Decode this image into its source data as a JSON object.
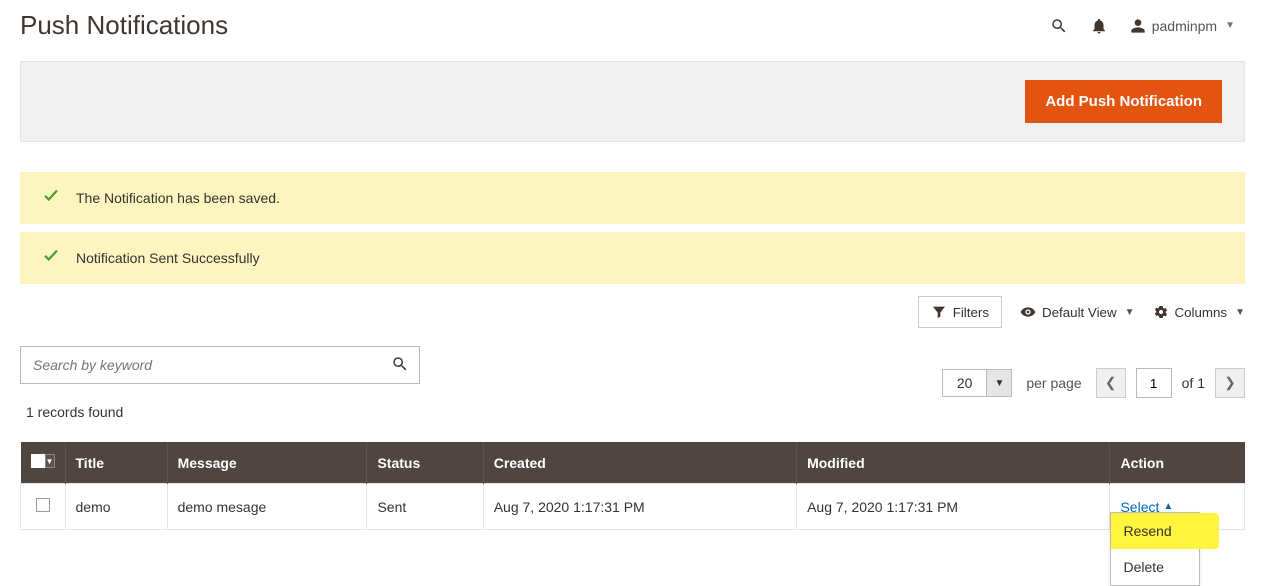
{
  "header": {
    "title": "Push Notifications",
    "user": "padminpm"
  },
  "primaryButton": "Add Push Notification",
  "messages": [
    "The Notification has been saved.",
    "Notification Sent Successfully"
  ],
  "toolbar": {
    "filters": "Filters",
    "defaultView": "Default View",
    "columns": "Columns"
  },
  "search": {
    "placeholder": "Search by keyword",
    "recordsFound": "1 records found"
  },
  "pager": {
    "perPageValue": "20",
    "perPageLabel": "per page",
    "current": "1",
    "ofLabel": "of 1"
  },
  "table": {
    "columns": {
      "title": "Title",
      "message": "Message",
      "status": "Status",
      "created": "Created",
      "modified": "Modified",
      "action": "Action"
    },
    "rows": [
      {
        "title": "demo",
        "message": "demo mesage",
        "status": "Sent",
        "created": "Aug 7, 2020 1:17:31 PM",
        "modified": "Aug 7, 2020 1:17:31 PM"
      }
    ],
    "actionSelect": "Select",
    "actionOptions": {
      "resend": "Resend",
      "delete": "Delete"
    }
  }
}
